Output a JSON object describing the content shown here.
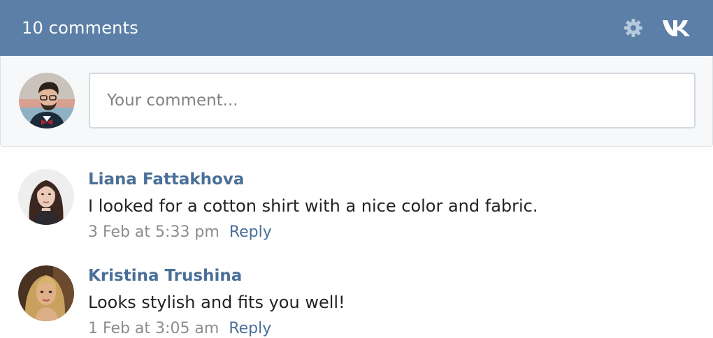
{
  "header": {
    "title": "10 comments",
    "settings_icon": "gear-icon",
    "brand_icon": "vk-logo-icon"
  },
  "compose": {
    "placeholder": "Your comment..."
  },
  "comments": [
    {
      "author": "Liana Fattakhova",
      "text": "I looked for a cotton shirt with a nice color and fabric.",
      "date": "3 Feb at 5:33 pm",
      "reply_label": "Reply"
    },
    {
      "author": "Kristina Trushina",
      "text": "Looks stylish and fits you well!",
      "date": "1 Feb at 3:05 am",
      "reply_label": "Reply"
    }
  ],
  "colors": {
    "header_bg": "#5b7fa6",
    "link": "#4a6f98",
    "muted": "#8c8c8c",
    "text": "#222222"
  }
}
